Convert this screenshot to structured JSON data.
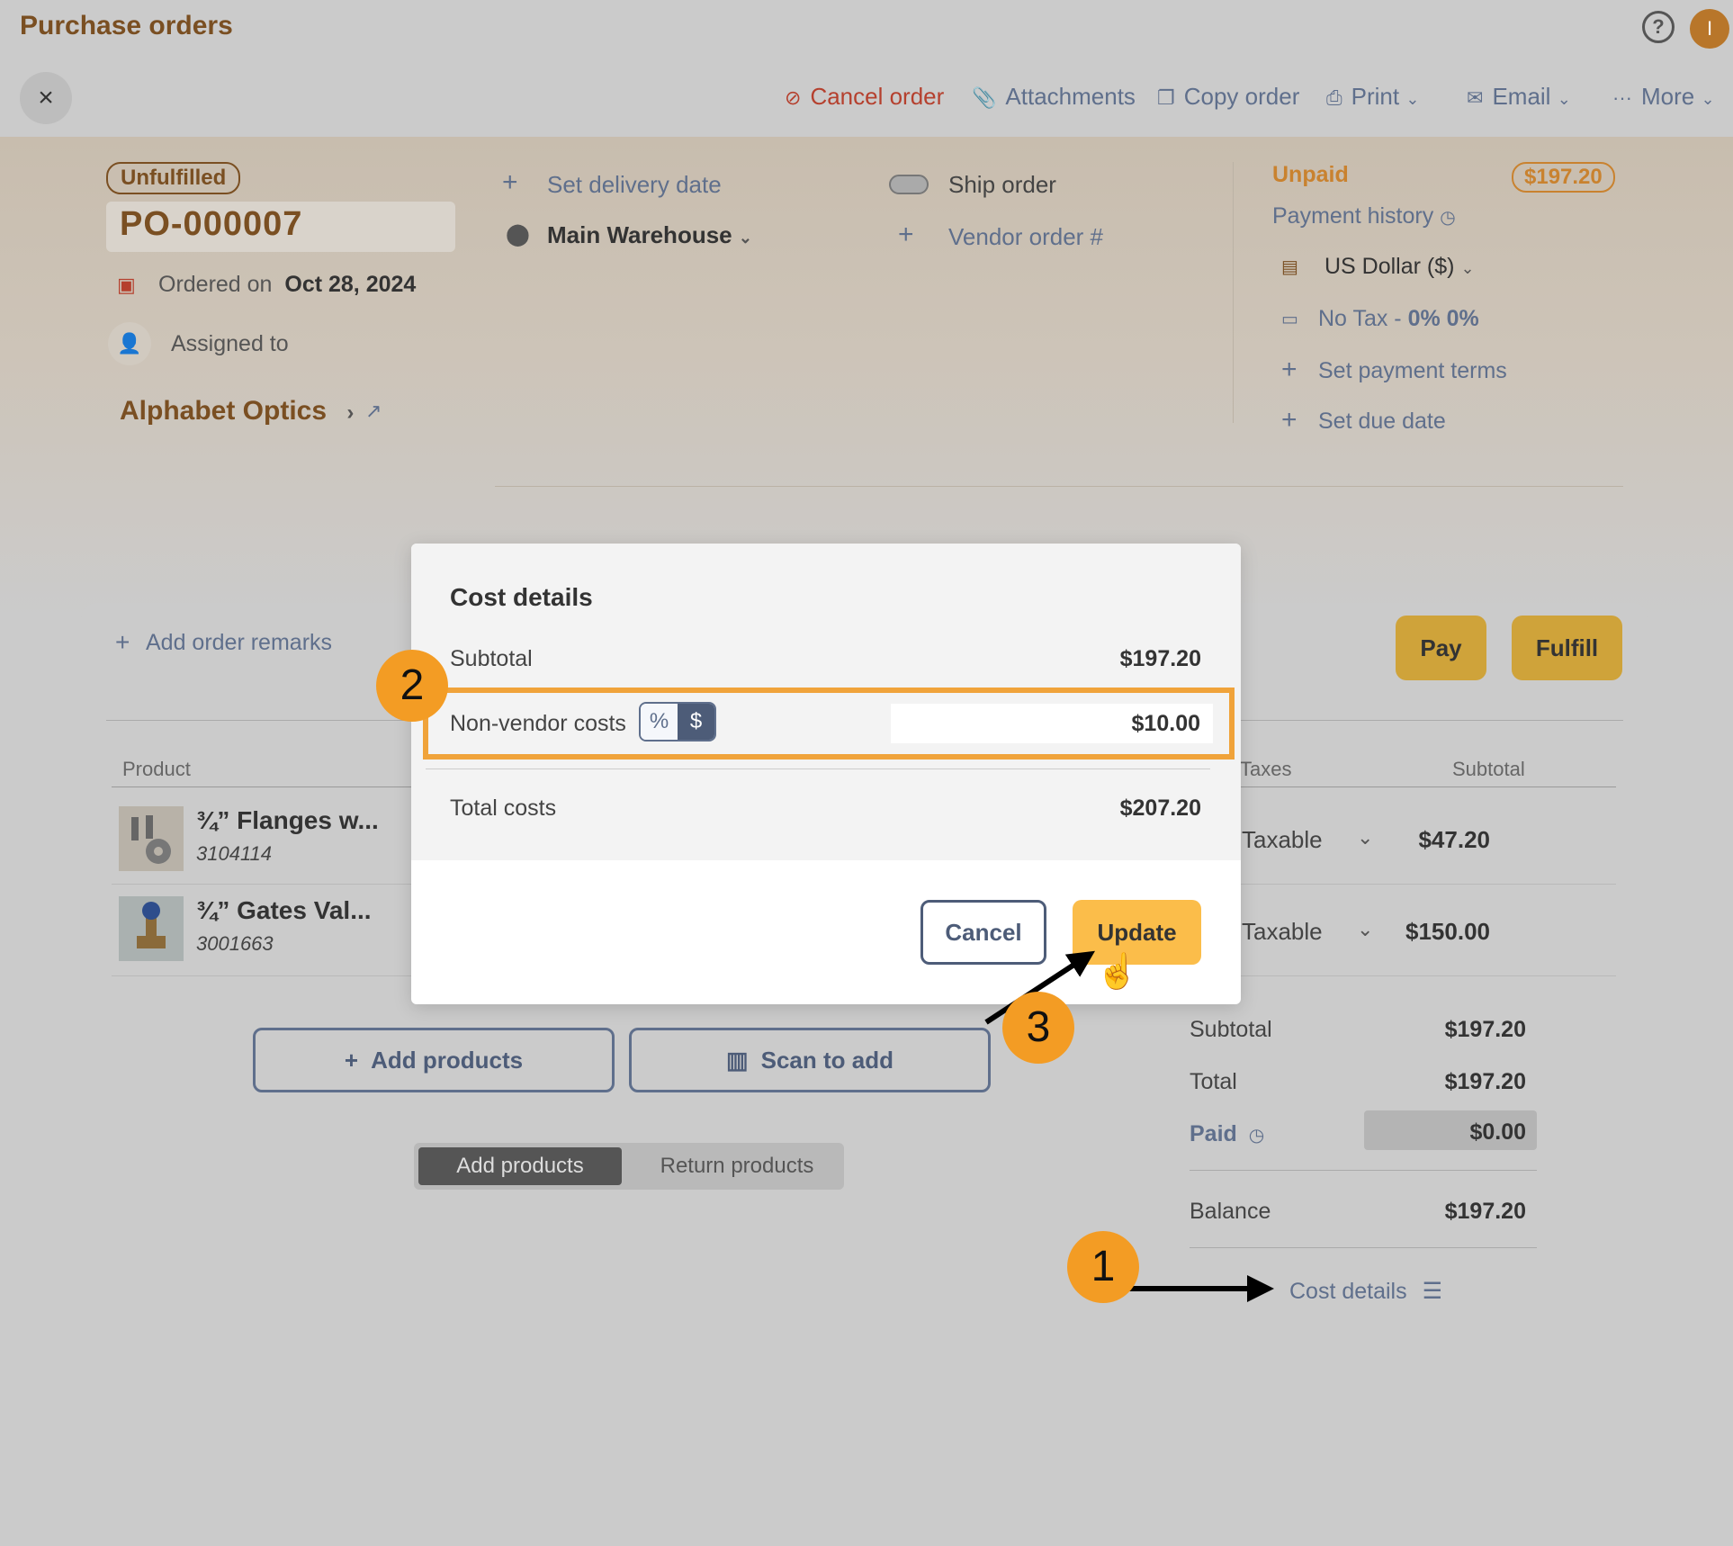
{
  "header": {
    "title": "Purchase orders",
    "toolbar": {
      "cancel_order": "Cancel order",
      "attachments": "Attachments",
      "copy_order": "Copy order",
      "print": "Print",
      "email": "Email",
      "more": "More"
    },
    "avatar_initial": "I",
    "help": "?"
  },
  "order": {
    "status": "Unfulfilled",
    "number": "PO-000007",
    "ordered_on_label": "Ordered on",
    "ordered_on_date": "Oct 28, 2024",
    "assigned_to": "Assigned to",
    "vendor": "Alphabet Optics",
    "set_delivery_date": "Set delivery date",
    "warehouse": "Main Warehouse",
    "ship_order": "Ship order",
    "vendor_order": "Vendor order #"
  },
  "payment": {
    "status": "Unpaid",
    "amount": "$197.20",
    "history": "Payment history",
    "currency": "US Dollar ($)",
    "tax_label": "No Tax - ",
    "tax_value": "0% 0%",
    "set_payment_terms": "Set payment terms",
    "set_due_date": "Set due date"
  },
  "actions": {
    "add_order_remarks": "Add order remarks",
    "pay": "Pay",
    "fulfill": "Fulfill"
  },
  "table": {
    "columns": {
      "product": "Product",
      "taxes": "Taxes",
      "subtotal": "Subtotal"
    },
    "rows": [
      {
        "name": "¾” Flanges w...",
        "sku": "3104114",
        "tax": "Taxable",
        "subtotal": "$47.20"
      },
      {
        "name": "¾” Gates Val...",
        "sku": "3001663",
        "tax": "Taxable",
        "subtotal": "$150.00"
      }
    ]
  },
  "buttons": {
    "add_products": "Add products",
    "scan_to_add": "Scan to add"
  },
  "segment": {
    "add": "Add products",
    "return": "Return products"
  },
  "summary": {
    "subtotal_label": "Subtotal",
    "subtotal": "$197.20",
    "total_label": "Total",
    "total": "$197.20",
    "paid_label": "Paid",
    "paid": "$0.00",
    "balance_label": "Balance",
    "balance": "$197.20",
    "cost_details": "Cost details"
  },
  "modal": {
    "title": "Cost details",
    "subtotal_label": "Subtotal",
    "subtotal": "$197.20",
    "non_vendor_label": "Non-vendor costs",
    "pct": "%",
    "usd": "$",
    "non_vendor_value": "$10.00",
    "total_label": "Total costs",
    "total": "$207.20",
    "cancel": "Cancel",
    "update": "Update"
  },
  "steps": {
    "one": "1",
    "two": "2",
    "three": "3"
  },
  "colors": {
    "accent": "#f39c24",
    "brand": "#7a4f22",
    "link": "#5f6f8c",
    "gold_button": "#cfa33a"
  }
}
